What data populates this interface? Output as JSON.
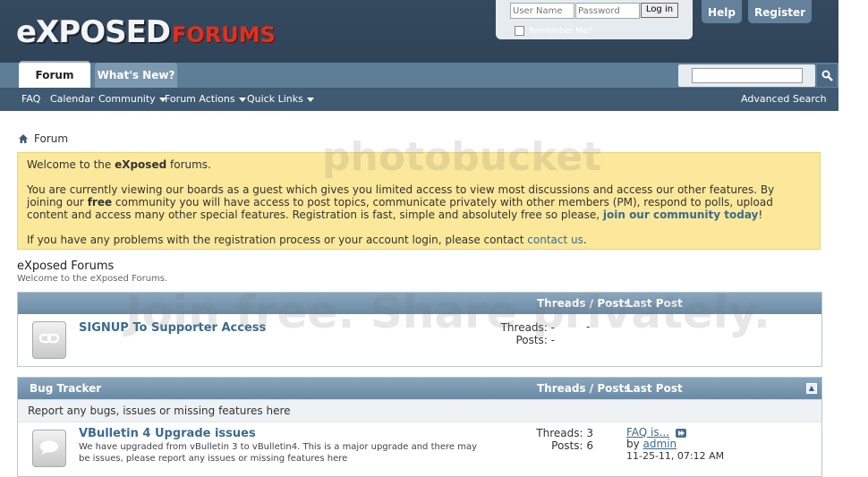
{
  "logo": {
    "main": "eXPOSED",
    "sub": "FORUMS"
  },
  "login": {
    "username_placeholder": "User Name",
    "password_placeholder": "Password",
    "login_label": "Log in",
    "remember_label": "Remember Me?"
  },
  "top_buttons": {
    "help": "Help",
    "register": "Register"
  },
  "tabs": [
    {
      "label": "Forum"
    },
    {
      "label": "What's New?"
    }
  ],
  "nav": [
    {
      "label": "FAQ"
    },
    {
      "label": "Calendar"
    },
    {
      "label": "Community"
    },
    {
      "label": "Forum Actions"
    },
    {
      "label": "Quick Links"
    }
  ],
  "advanced_search": "Advanced Search",
  "breadcrumb": "Forum",
  "notice": {
    "welcome_prefix": "Welcome to the ",
    "welcome_bold": "eXposed",
    "welcome_suffix": " forums.",
    "p2_a": "You are currently viewing our boards as a guest which gives you limited access to view most discussions and access our other features. By joining our ",
    "p2_free": "free",
    "p2_b": " community you will have access to post topics, communicate privately with other members (PM), respond to polls, upload content and access many other special features. Registration is fast, simple and absolutely free so please, ",
    "p2_join": "join our community today",
    "p2_c": "!",
    "p3_a": "If you have any problems with the registration process or your account login, please contact ",
    "p3_contact": "contact us",
    "p3_b": "."
  },
  "section": {
    "title": "eXposed Forums",
    "subtitle": "Welcome to the eXposed Forums."
  },
  "blocks": [
    {
      "title": "",
      "col_threads_posts": "Threads / Posts",
      "col_last_post": "Last Post",
      "forums": [
        {
          "name": "SIGNUP To Supporter Access",
          "desc": "",
          "threads": "Threads: -",
          "posts": "Posts: -",
          "last_post": "-"
        }
      ]
    },
    {
      "title": "Bug Tracker",
      "col_threads_posts": "Threads / Posts",
      "col_last_post": "Last Post",
      "description": "Report any bugs, issues or missing features here",
      "forums": [
        {
          "name": "VBulletin 4 Upgrade issues",
          "desc": "We have upgraded from vBulletin 3 to vBulletin4. This is a major upgrade and there may be issues, please report any issues or missing features here",
          "threads": "Threads: 3",
          "posts": "Posts: 6",
          "last_post_title": "FAQ is...",
          "last_post_by_label": "by ",
          "last_post_by": "admin",
          "last_post_date": "11-25-11, 07:12 AM"
        }
      ]
    }
  ],
  "watermark": {
    "top": "photobucket",
    "bottom": "Join free. Share privately."
  },
  "colors": {
    "header": "#3f5a72",
    "tabbar": "#5e7d97",
    "notice": "#fbe89a",
    "link": "#3b6b8f"
  },
  "icons": [
    "home-icon",
    "search-icon",
    "collapse-icon",
    "forum-link-icon",
    "forum-chat-icon",
    "go-last-post-icon"
  ]
}
